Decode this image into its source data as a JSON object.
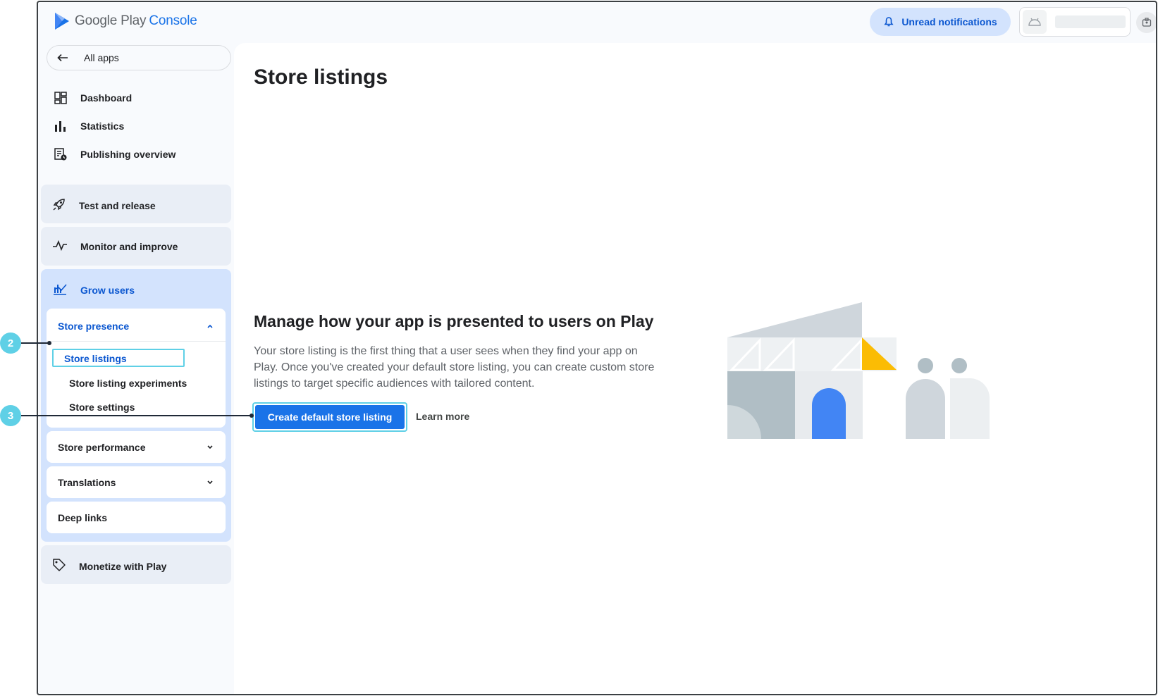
{
  "brand": {
    "name": "Google Play",
    "product": "Console"
  },
  "topbar": {
    "notifications_label": "Unread notifications"
  },
  "nav": {
    "all_apps": "All apps",
    "primary": [
      {
        "label": "Dashboard",
        "icon": "dashboard-icon"
      },
      {
        "label": "Statistics",
        "icon": "bar-chart-icon"
      },
      {
        "label": "Publishing overview",
        "icon": "publishing-icon"
      }
    ],
    "sections": {
      "test_release": "Test and release",
      "monitor": "Monitor and improve",
      "grow": "Grow users",
      "monetize": "Monetize with Play"
    },
    "store_presence": {
      "title": "Store presence",
      "items": [
        "Store listings",
        "Store listing experiments",
        "Store settings"
      ]
    },
    "store_performance": "Store performance",
    "translations": "Translations",
    "deep_links": "Deep links"
  },
  "main": {
    "title": "Store listings",
    "heading": "Manage how your app is presented to users on Play",
    "body": "Your store listing is the first thing that a user sees when they find your app on Play. Once you've created your default store listing, you can create custom store listings to target specific audiences with tailored content.",
    "primary_button": "Create default store listing",
    "learn_more": "Learn more"
  },
  "callouts": [
    "2",
    "3"
  ],
  "colors": {
    "accent": "#1a73e8",
    "active_bg": "#d3e3fd",
    "callout": "#5fd0e6",
    "illustration_yellow": "#fbbc04"
  }
}
